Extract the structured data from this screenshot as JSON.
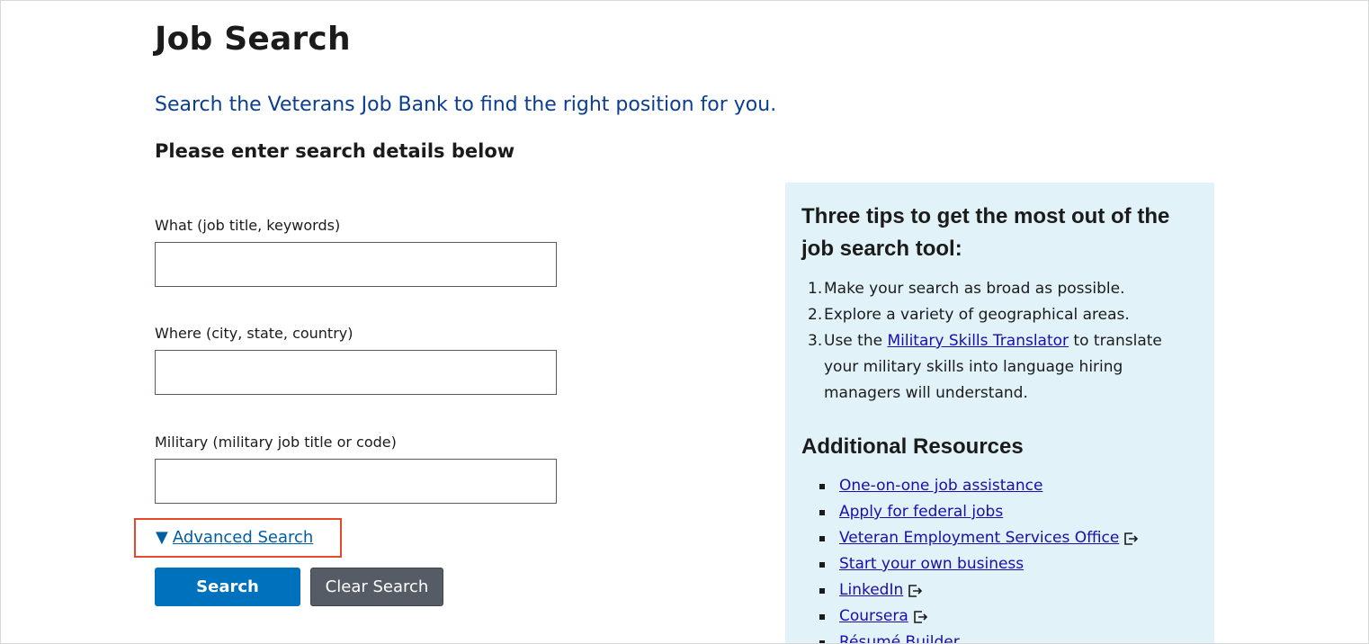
{
  "page": {
    "title": "Job Search",
    "lead": "Search the Veterans Job Bank to find the right position for you.",
    "subhead": "Please enter search details below"
  },
  "form": {
    "what_label": "What (job title, keywords)",
    "what_value": "",
    "where_label": "Where (city, state, country)",
    "where_value": "",
    "military_label": "Military (military job title or code)",
    "military_value": "",
    "advanced_triangle": "▼",
    "advanced_label": "Advanced Search",
    "search_button": "Search",
    "clear_button": "Clear Search"
  },
  "sidebar": {
    "tips_heading": "Three tips to get the most out of the job search tool:",
    "tips": [
      {
        "num": "1.",
        "text": "Make your search as broad as possible."
      },
      {
        "num": "2.",
        "text": "Explore a variety of geographical areas."
      },
      {
        "num": "3.",
        "pre": "Use the ",
        "link": "Military Skills Translator",
        "post": " to translate your military skills into language hiring managers will understand."
      }
    ],
    "resources_heading": "Additional Resources",
    "resources": [
      {
        "label": "One-on-one job assistance",
        "external": false
      },
      {
        "label": "Apply for federal jobs",
        "external": false
      },
      {
        "label": "Veteran Employment Services Office",
        "external": true
      },
      {
        "label": "Start your own business",
        "external": false
      },
      {
        "label": "LinkedIn",
        "external": true
      },
      {
        "label": "Coursera",
        "external": true
      },
      {
        "label": "Résumé Builder",
        "external": false
      }
    ]
  },
  "colors": {
    "lead_text": "#0b3d91",
    "primary_button": "#0071bc",
    "secondary_button": "#565c65",
    "sidebar_bg": "#e1f3f8",
    "highlight_border": "#e8472c"
  }
}
